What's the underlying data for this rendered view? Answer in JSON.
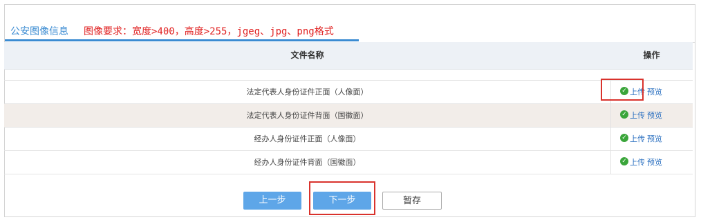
{
  "tab": {
    "title": "公安图像信息",
    "requirement": "图像要求：宽度>400，高度>255，jgeg、jpg、png格式"
  },
  "table": {
    "headers": [
      "文件名称",
      "操作"
    ],
    "rows": [
      {
        "name": "法定代表人身份证件正面（人像面）",
        "upload": "上传",
        "preview": "预览"
      },
      {
        "name": "法定代表人身份证件背面（国徽面）",
        "upload": "上传",
        "preview": "预览"
      },
      {
        "name": "经办人身份证件正面（人像面）",
        "upload": "上传",
        "preview": "预览"
      },
      {
        "name": "经办人身份证件背面（国徽面）",
        "upload": "上传",
        "preview": "预览"
      }
    ]
  },
  "buttons": {
    "prev": "上一步",
    "next": "下一步",
    "save": "暂存"
  },
  "colors": {
    "accent": "#3a8bd2",
    "warning_text": "#e02020",
    "highlight_box": "#d9322c",
    "primary_button": "#5ea6e8"
  }
}
